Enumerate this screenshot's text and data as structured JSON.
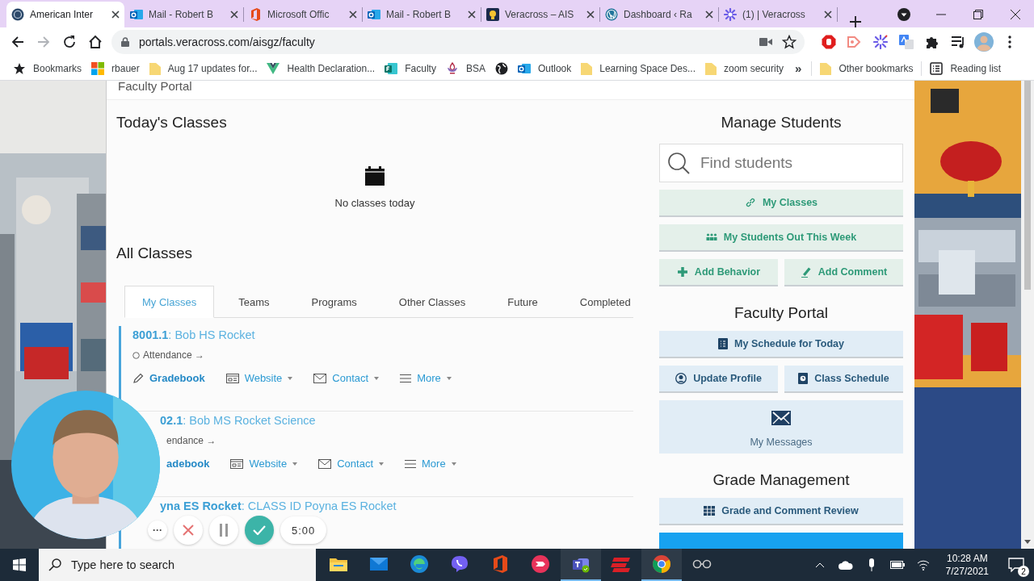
{
  "browser": {
    "tabs": [
      {
        "title": "American Inter",
        "kind": "globe",
        "selected": true
      },
      {
        "title": "Mail - Robert B",
        "kind": "outlook",
        "selected": false
      },
      {
        "title": "Microsoft Offic",
        "kind": "office",
        "selected": false
      },
      {
        "title": "Mail - Robert B",
        "kind": "outlook",
        "selected": false
      },
      {
        "title": "Veracross – AIS",
        "kind": "bulb",
        "selected": false
      },
      {
        "title": "Dashboard ‹ Ra",
        "kind": "wordpress",
        "selected": false
      },
      {
        "title": "(1) | Veracross",
        "kind": "asterisk",
        "selected": false
      }
    ],
    "url": "portals.veracross.com/aisgz/faculty",
    "bookmarks": [
      {
        "label": "Bookmarks",
        "kind": "star"
      },
      {
        "label": "rbauer",
        "kind": "windows"
      },
      {
        "label": "Aug 17 updates for...",
        "kind": "folder"
      },
      {
        "label": "Health Declaration...",
        "kind": "vue"
      },
      {
        "label": "Faculty",
        "kind": "forms"
      },
      {
        "label": "BSA",
        "kind": "fleur"
      },
      {
        "kind": "globe"
      },
      {
        "label": "Outlook",
        "kind": "outlook"
      },
      {
        "label": "Learning Space Des...",
        "kind": "folder"
      },
      {
        "label": "zoom security",
        "kind": "folder"
      },
      {
        "label": "»",
        "kind": "more"
      },
      {
        "label": "Other bookmarks",
        "kind": "folder"
      },
      {
        "label": "Reading list",
        "kind": "reading"
      }
    ]
  },
  "header": {
    "title": "Faculty Portal"
  },
  "todays_classes": {
    "title": "Today's Classes",
    "empty_message": "No classes today"
  },
  "all_classes": {
    "title": "All Classes",
    "tabs": [
      {
        "label": "My Classes",
        "selected": true
      },
      {
        "label": "Teams",
        "selected": false
      },
      {
        "label": "Programs",
        "selected": false
      },
      {
        "label": "Other Classes",
        "selected": false
      },
      {
        "label": "Future",
        "selected": false
      },
      {
        "label": "Completed",
        "selected": false
      }
    ],
    "classes": [
      {
        "code": "8001.1",
        "name": ": Bob HS Rocket",
        "overlapped": false,
        "attendance": "Attendance →",
        "actions": [
          {
            "label": "Gradebook",
            "kind": "gradebook"
          },
          {
            "label": "Website",
            "kind": "website"
          },
          {
            "label": "Contact",
            "kind": "contact"
          },
          {
            "label": "More",
            "kind": "more"
          }
        ]
      },
      {
        "code": "02.1",
        "name": ": Bob MS Rocket Science",
        "overlapped": true,
        "attendance": "endance →",
        "actions": [
          {
            "label": "adebook",
            "kind": "gradebook"
          },
          {
            "label": "Website",
            "kind": "website"
          },
          {
            "label": "Contact",
            "kind": "contact"
          },
          {
            "label": "More",
            "kind": "more"
          }
        ]
      },
      {
        "code": "yna ES Rocket",
        "name": ": CLASS ID Poyna ES Rocket",
        "overlapped": true
      }
    ]
  },
  "manage_students": {
    "title": "Manage Students",
    "search": {
      "placeholder": "Find students"
    },
    "rows": [
      {
        "buttons": [
          {
            "label": "My Classes",
            "kind": "link"
          }
        ]
      },
      {
        "buttons": [
          {
            "label": "My Students Out This Week",
            "kind": "group"
          }
        ]
      },
      {
        "buttons": [
          {
            "label": "Add Behavior",
            "kind": "plus"
          },
          {
            "label": "Add Comment",
            "kind": "pen"
          }
        ]
      }
    ]
  },
  "faculty_portal": {
    "title": "Faculty Portal",
    "rows": [
      {
        "buttons": [
          {
            "label": "My Schedule for Today",
            "kind": "schedule"
          }
        ]
      },
      {
        "buttons": [
          {
            "label": "Update Profile",
            "kind": "profile"
          },
          {
            "label": "Class Schedule",
            "kind": "clock"
          }
        ]
      },
      {
        "buttons": [
          {
            "label": "My Messages",
            "kind": "envelope"
          }
        ]
      }
    ]
  },
  "grade_management": {
    "title": "Grade Management",
    "rows": [
      {
        "buttons": [
          {
            "label": "Grade and Comment Review",
            "kind": "grid"
          }
        ]
      },
      {
        "buttons": [
          {
            "kind": "primary"
          }
        ]
      }
    ]
  },
  "timer": {
    "controls": [
      {
        "kind": "more",
        "label": "···"
      },
      {
        "kind": "cancel"
      },
      {
        "kind": "pause"
      },
      {
        "kind": "done"
      }
    ],
    "time": "5:00"
  },
  "taskbar": {
    "search": {
      "placeholder": "Type here to search"
    },
    "apps": [
      {
        "kind": "explorer",
        "active": false
      },
      {
        "kind": "mail",
        "active": false
      },
      {
        "kind": "edge",
        "active": false
      },
      {
        "kind": "viber",
        "active": false
      },
      {
        "kind": "office",
        "active": false
      },
      {
        "kind": "cast",
        "active": false
      },
      {
        "kind": "teams",
        "active": true
      },
      {
        "kind": "express",
        "active": false
      },
      {
        "kind": "chrome",
        "active": true
      },
      {
        "kind": "glasses",
        "active": false
      }
    ],
    "time": "10:28 AM",
    "date": "7/27/2021",
    "notifications": "2"
  }
}
